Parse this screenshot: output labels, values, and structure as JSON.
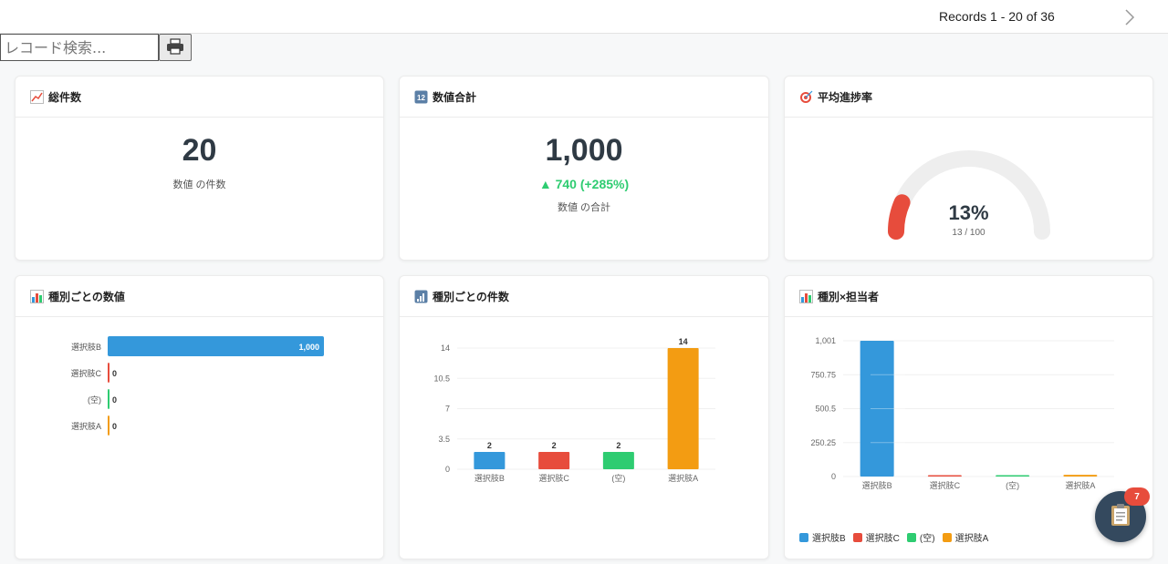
{
  "pager": {
    "records_text": "Records 1 - 20 of 36",
    "next_icon": "chevron-right-icon"
  },
  "search": {
    "placeholder": "レコード検索...",
    "print_icon": "printer-icon"
  },
  "cards": {
    "total": {
      "icon": "chart-increasing-icon",
      "title": "総件数",
      "value": "20",
      "label": "数値 の件数"
    },
    "sum": {
      "icon": "input-numbers-icon",
      "title": "数値合計",
      "value": "1,000",
      "delta": "▲ 740 (+285%)",
      "label": "数値 の合計"
    },
    "progress": {
      "icon": "target-icon",
      "title": "平均進捗率",
      "value": "13%",
      "detail": "13 / 100",
      "percent": 13
    },
    "by_type_value": {
      "icon": "bar-chart-icon",
      "title": "種別ごとの数値"
    },
    "by_type_count": {
      "icon": "signal-bars-icon",
      "title": "種別ごとの件数"
    },
    "by_type_owner": {
      "icon": "bar-chart-icon",
      "title": "種別×担当者"
    }
  },
  "colors": {
    "blue": "#3498db",
    "red": "#e74c3c",
    "green": "#2ecc71",
    "orange": "#f39c12",
    "gauge_bg": "#eeeeee"
  },
  "chart_data": [
    {
      "type": "bar",
      "orientation": "horizontal",
      "categories": [
        "選択肢B",
        "選択肢C",
        "(空)",
        "選択肢A"
      ],
      "values": [
        1000,
        0,
        0,
        0
      ],
      "value_labels": [
        "1,000",
        "0",
        "0",
        "0"
      ],
      "colors": [
        "#3498db",
        "#e74c3c",
        "#2ecc71",
        "#f39c12"
      ]
    },
    {
      "type": "bar",
      "categories": [
        "選択肢B",
        "選択肢C",
        "(空)",
        "選択肢A"
      ],
      "values": [
        2,
        2,
        2,
        14
      ],
      "value_labels": [
        "2",
        "2",
        "2",
        "14"
      ],
      "yticks": [
        "0",
        "3.5",
        "7",
        "10.5",
        "14"
      ],
      "ylim": [
        0,
        14
      ],
      "colors": [
        "#3498db",
        "#e74c3c",
        "#2ecc71",
        "#f39c12"
      ]
    },
    {
      "type": "bar",
      "categories": [
        "選択肢B",
        "選択肢C",
        "(空)",
        "選択肢A"
      ],
      "values": [
        1001,
        1,
        1,
        13
      ],
      "yticks": [
        "0",
        "250.25",
        "500.5",
        "750.75",
        "1,001"
      ],
      "ylim": [
        0,
        1001
      ],
      "colors": [
        "#3498db",
        "#e74c3c",
        "#2ecc71",
        "#f39c12"
      ],
      "legend": [
        "選択肢B",
        "選択肢C",
        "(空)",
        "選択肢A"
      ],
      "legend_position": "bottom-left"
    }
  ],
  "fab": {
    "icon": "clipboard-icon",
    "badge": "7"
  }
}
